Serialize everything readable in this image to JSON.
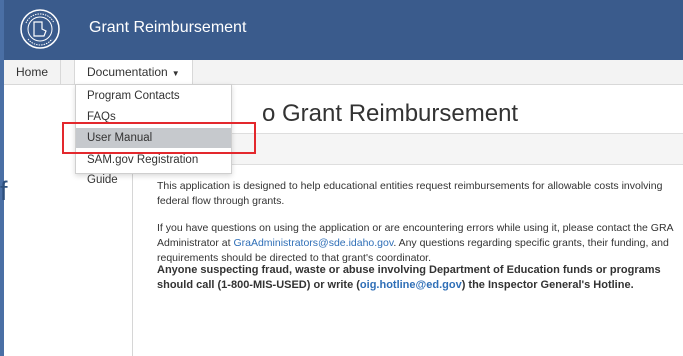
{
  "header": {
    "app_title": "Grant Reimbursement",
    "logo_alt": "Idaho Department of Education seal",
    "logo_text": "IDAHO DEPARTMENT OF EDUCATION"
  },
  "nav": {
    "home": "Home",
    "documentation": "Documentation",
    "caret": "▼"
  },
  "dropdown": {
    "items": [
      "Program Contacts",
      "FAQs",
      "User Manual",
      "SAM.gov Registration Guide"
    ],
    "selected": "User Manual"
  },
  "main": {
    "title_partial": "o Grant Reimbursement",
    "para1": "This application is designed to help educational entities request reimbursements for allowable costs involving federal flow through grants.",
    "para2_a": "If you have questions on using the application or are encountering errors while using it, please contact the GRA Administrator at ",
    "para2_email": "GraAdministrators@sde.idaho.gov",
    "para2_b": ". Any questions regarding specific grants, their funding, and requirements should be directed to that grant's coordinator.",
    "para3_a": "Anyone suspecting fraud, waste or abuse involving Department of Education funds or programs should call (1-800-MIS-USED) or write (",
    "para3_email": "oig.hotline@ed.gov",
    "para3_b": ") the Inspector General's Hotline."
  },
  "stray_text": "f",
  "colors": {
    "header_bg": "#3a5b8c",
    "highlight_border": "#e3282d",
    "link": "#2f6fb7",
    "menu_selected_bg": "#c6c9cd"
  }
}
